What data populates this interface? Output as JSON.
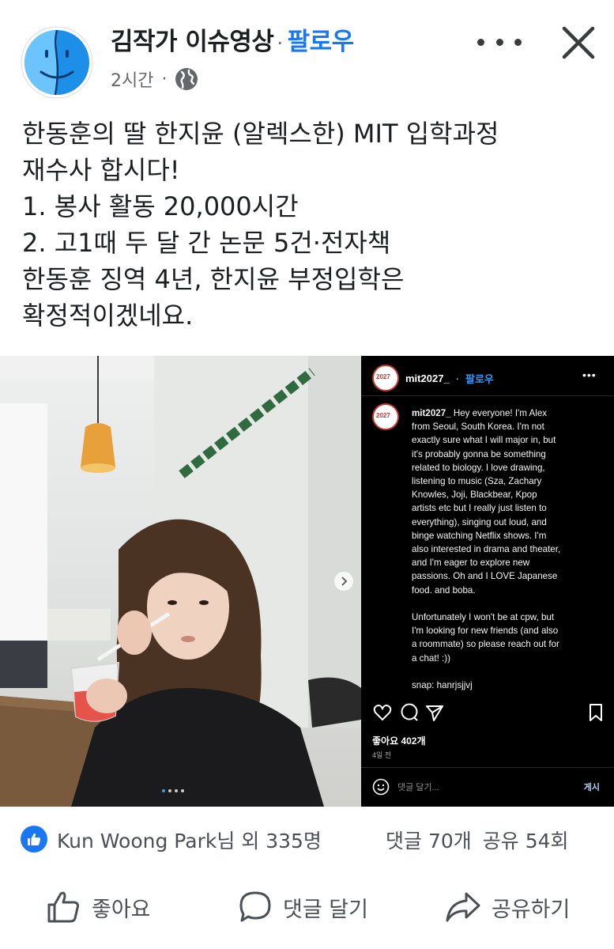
{
  "header": {
    "author": "김작가 이슈영상",
    "separator": "·",
    "follow_label": "팔로우",
    "timestamp": "2시간",
    "meta_separator": "·",
    "privacy_icon": "globe-icon",
    "more_icon": "more-horizontal-icon",
    "close_icon": "close-icon"
  },
  "post": {
    "lines": [
      "한동훈의 딸 한지윤 (알렉스한) MIT 입학과정",
      "재수사 합시다!",
      "1. 봉사 활동 20,000시간",
      "2. 고1때 두 달 간 논문 5건·전자책",
      "한동훈 징역 4년, 한지윤 부정입학은",
      "확정적이겠네요."
    ]
  },
  "instagram": {
    "username": "mit2027_",
    "separator": "·",
    "follow_label": "팔로우",
    "more": "•••",
    "caption_user": "mit2027_",
    "caption_body": " Hey everyone! I'm Alex\nfrom Seoul, South Korea. I'm not\nexactly sure what I will major in, but\nit's probably gonna be something\nrelated to biology. I love drawing,\nlistening to music (Sza, Zachary\nKnowles, Joji, Blackbear, Kpop\nartists etc but I really just listen to\neverything), singing out loud, and\nbinge watching Netflix shows. I'm\nalso interested in drama and theater,\nand I'm eager to explore new\npassions. Oh and I LOVE Japanese\nfood. and boba.\n\nUnfortunately I won't be at cpw, but\nI'm looking for new friends (and also\na roommate) so please reach out for\na chat! :))\n\nsnap: hanrjsjjvj",
    "likes": "좋아요 402개",
    "time": "4일 전",
    "comment_placeholder": "댓글 달기...",
    "post_label": "게시",
    "carousel_active_index": 0,
    "carousel_count": 4
  },
  "reactions": {
    "reactors": "Kun Woong Park님 외 335명",
    "comments": "댓글 70개",
    "shares": "공유 54회"
  },
  "actions": {
    "like": "좋아요",
    "comment": "댓글 달기",
    "share": "공유하기"
  },
  "colors": {
    "brand_blue": "#1877f2",
    "text": "#1c1e21",
    "secondary": "#65676b"
  }
}
